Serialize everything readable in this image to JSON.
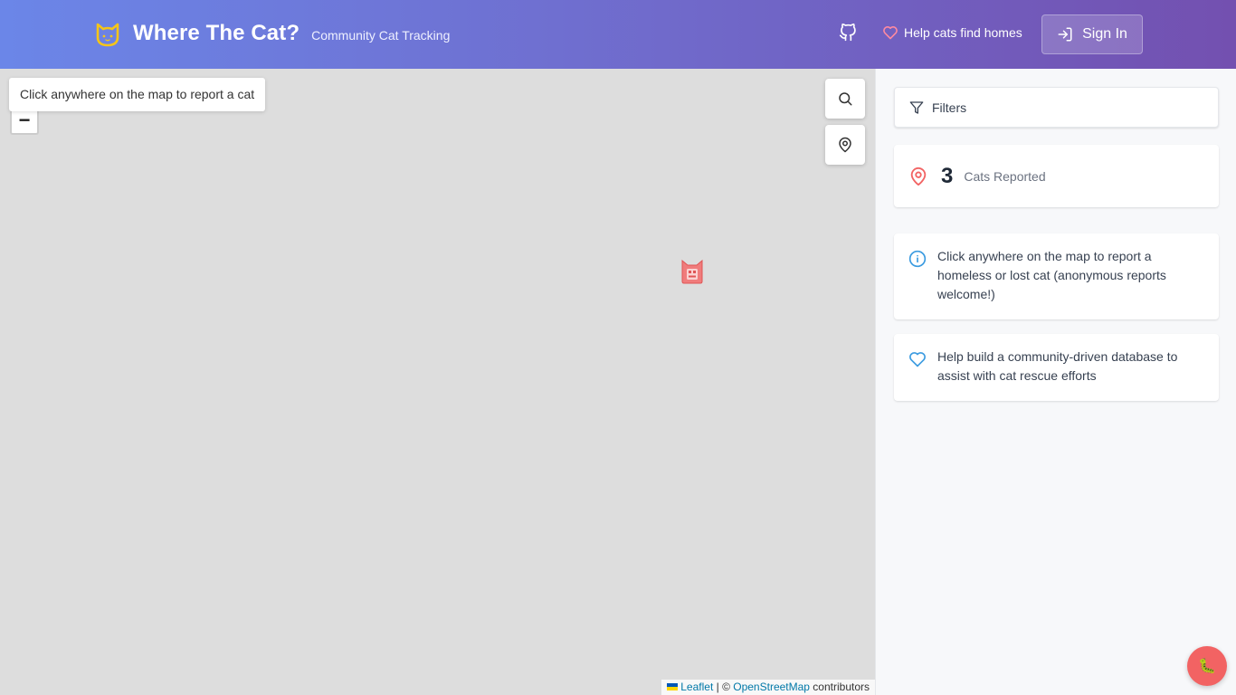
{
  "header": {
    "app_title": "Where The Cat?",
    "subtitle": "Community Cat Tracking",
    "logo_icon": "cat-face-icon",
    "github_icon": "github-icon",
    "help_link": "Help cats find homes",
    "sign_in_label": "Sign In"
  },
  "map": {
    "hint": "Click anywhere on the map to report a cat",
    "zoom_out_label": "−",
    "search_icon": "search-icon",
    "locate_icon": "location-pin-icon",
    "marker_icon": "cat-marker-icon",
    "attribution": {
      "leaflet": "Leaflet",
      "separator": " | © ",
      "osm": "OpenStreetMap",
      "suffix": " contributors"
    }
  },
  "sidebar": {
    "filters_label": "Filters",
    "stats": {
      "count": "3",
      "label": "Cats Reported"
    },
    "info_items": [
      {
        "icon": "info-icon",
        "text": "Click anywhere on the map to report a homeless or lost cat (anonymous reports welcome!)"
      },
      {
        "icon": "heart-icon",
        "text": "Help build a community-driven database to assist with cat rescue efforts"
      }
    ]
  },
  "fab": {
    "icon": "bug-icon",
    "label": "🐛"
  },
  "colors": {
    "header_gradient_start": "#6b86e8",
    "header_gradient_end": "#7350b0",
    "accent_red": "#f26363",
    "info_blue": "#3b9be0",
    "logo_yellow": "#f5c518"
  }
}
